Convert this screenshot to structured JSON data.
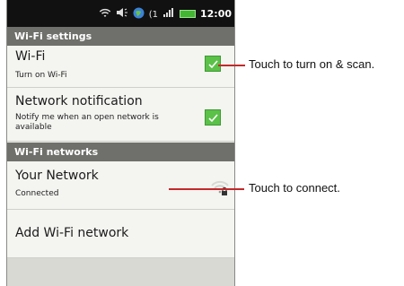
{
  "status_bar": {
    "time": "12:00",
    "carrier_tag": "1"
  },
  "wifi_settings_section": {
    "header": "Wi-Fi settings",
    "wifi_row": {
      "title": "Wi-Fi",
      "subtitle": "Turn on Wi-Fi",
      "checked": true
    },
    "notification_row": {
      "title": "Network notification",
      "subtitle": "Notify me when an open network is available",
      "checked": true
    }
  },
  "wifi_networks_section": {
    "header": "Wi-Fi networks",
    "network_row": {
      "title": "Your Network",
      "subtitle": "Connected",
      "icon": "wifi-locked-icon"
    },
    "add_row": {
      "title": "Add Wi-Fi network"
    }
  },
  "callouts": {
    "wifi_toggle": "Touch to turn on & scan.",
    "network": "Touch to connect."
  },
  "colors": {
    "accent_green": "#5bc149",
    "header_gray": "#6f6f6b",
    "callout_red": "#c22a2a"
  }
}
